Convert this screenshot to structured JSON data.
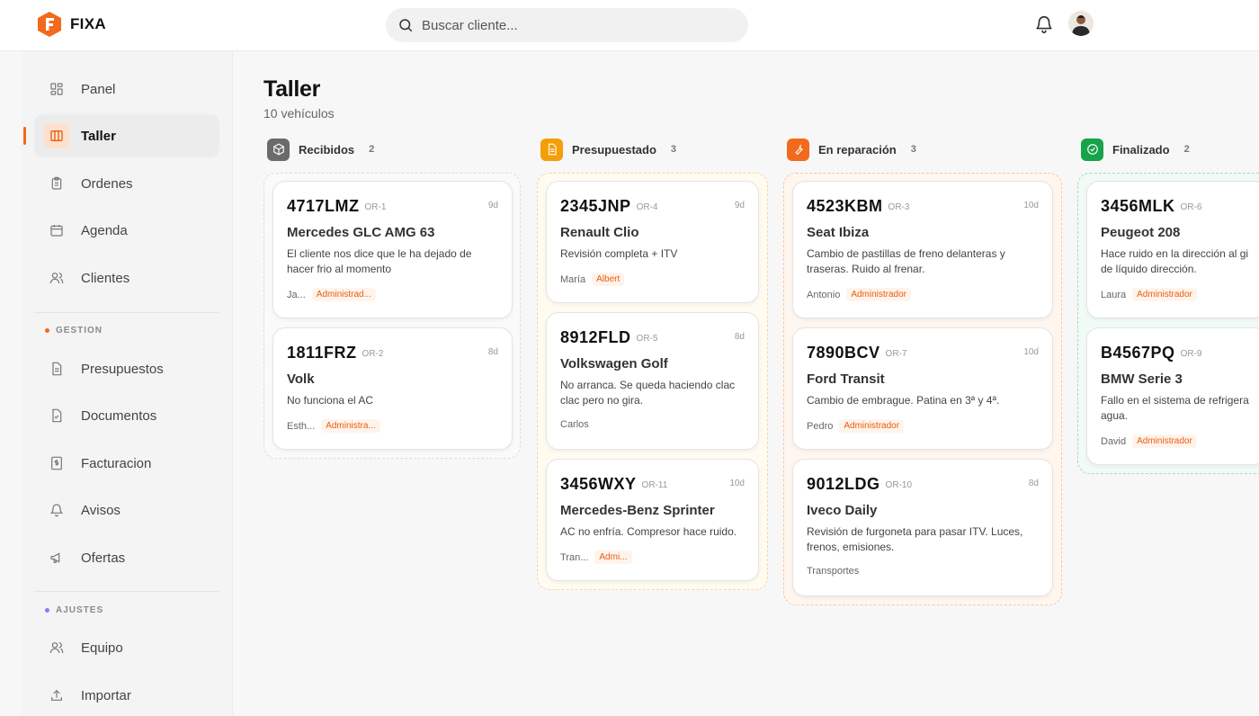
{
  "app": {
    "name": "FIXA"
  },
  "search": {
    "placeholder": "Buscar cliente..."
  },
  "sidebar": {
    "items": [
      {
        "label": "Panel",
        "icon": "grid-icon"
      },
      {
        "label": "Taller",
        "icon": "kanban-icon",
        "active": true
      },
      {
        "label": "Ordenes",
        "icon": "clipboard-icon"
      },
      {
        "label": "Agenda",
        "icon": "calendar-icon"
      },
      {
        "label": "Clientes",
        "icon": "users-icon"
      }
    ],
    "section_gestion": "GESTION",
    "gestion_items": [
      {
        "label": "Presupuestos",
        "icon": "document-icon"
      },
      {
        "label": "Documentos",
        "icon": "file-check-icon"
      },
      {
        "label": "Facturacion",
        "icon": "invoice-icon"
      },
      {
        "label": "Avisos",
        "icon": "bell-icon"
      },
      {
        "label": "Ofertas",
        "icon": "megaphone-icon"
      }
    ],
    "section_ajustes": "AJUSTES",
    "ajustes_items": [
      {
        "label": "Equipo",
        "icon": "users-icon"
      },
      {
        "label": "Importar",
        "icon": "upload-icon"
      }
    ]
  },
  "main": {
    "title": "Taller",
    "subtitle": "10 vehículos",
    "columns": [
      {
        "name": "Recibidos",
        "count": "2",
        "icon": "box-icon",
        "cards": [
          {
            "plate": "4717LMZ",
            "order": "OR-1",
            "age": "9d",
            "model": "Mercedes GLC AMG 63",
            "desc1": "El cliente nos dice que le ha dejado de",
            "desc2": "hacer frio al momento",
            "client": "Ja...",
            "tag": "Administrad..."
          },
          {
            "plate": "1811FRZ",
            "order": "OR-2",
            "age": "8d",
            "model": "Volk",
            "desc1": "No funciona el AC",
            "desc2": "",
            "client": "Esth...",
            "tag": "Administra..."
          }
        ]
      },
      {
        "name": "Presupuestado",
        "count": "3",
        "icon": "document-icon",
        "cards": [
          {
            "plate": "2345JNP",
            "order": "OR-4",
            "age": "9d",
            "model": "Renault Clio",
            "desc1": "Revisión completa + ITV",
            "desc2": "",
            "client": "María",
            "tag": "Albert"
          },
          {
            "plate": "8912FLD",
            "order": "OR-5",
            "age": "8d",
            "model": "Volkswagen Golf",
            "desc1": "No arranca. Se queda haciendo clac",
            "desc2": "clac pero no gira.",
            "client": "Carlos",
            "tag": ""
          },
          {
            "plate": "3456WXY",
            "order": "OR-11",
            "age": "10d",
            "model": "Mercedes-Benz Sprinter",
            "desc1": "AC no enfría. Compresor hace ruido.",
            "desc2": "",
            "client": "Tran...",
            "tag": "Admi..."
          }
        ]
      },
      {
        "name": "En reparación",
        "count": "3",
        "icon": "wrench-icon",
        "cards": [
          {
            "plate": "4523KBM",
            "order": "OR-3",
            "age": "10d",
            "model": "Seat Ibiza",
            "desc1": "Cambio de pastillas de freno delanteras y",
            "desc2": "traseras. Ruido al frenar.",
            "client": "Antonio",
            "tag": "Administrador"
          },
          {
            "plate": "7890BCV",
            "order": "OR-7",
            "age": "10d",
            "model": "Ford Transit",
            "desc1": "Cambio de embrague. Patina en 3ª y 4ª.",
            "desc2": "",
            "client": "Pedro",
            "tag": "Administrador"
          },
          {
            "plate": "9012LDG",
            "order": "OR-10",
            "age": "8d",
            "model": "Iveco Daily",
            "desc1": "Revisión de furgoneta para pasar ITV. Luces,",
            "desc2": "frenos, emisiones.",
            "client": "Transportes",
            "tag": ""
          }
        ]
      },
      {
        "name": "Finalizado",
        "count": "2",
        "icon": "check-circle-icon",
        "cards": [
          {
            "plate": "3456MLK",
            "order": "OR-6",
            "age": "",
            "model": "Peugeot 208",
            "desc1": "Hace ruido en la dirección al gi",
            "desc2": "de líquido dirección.",
            "client": "Laura",
            "tag": "Administrador"
          },
          {
            "plate": "B4567PQ",
            "order": "OR-9",
            "age": "",
            "model": "BMW Serie 3",
            "desc1": "Fallo en el sistema de refrigera",
            "desc2": "agua.",
            "client": "David",
            "tag": "Administrador"
          }
        ]
      }
    ]
  },
  "colors": {
    "accent": "#f26a1b",
    "recibidos": "#6b6b6b",
    "presupuestado": "#f59e0b",
    "reparacion": "#f26a1b",
    "finalizado": "#16a34a"
  }
}
